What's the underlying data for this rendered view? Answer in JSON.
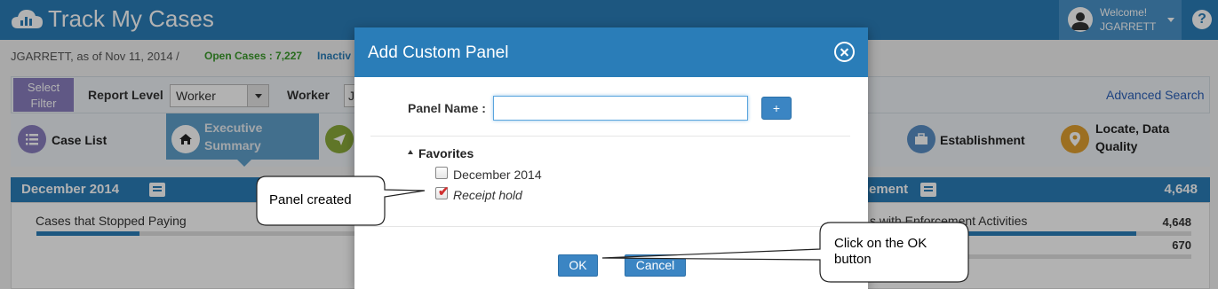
{
  "app": {
    "title": "Track My Cases",
    "user_greeting": "Welcome!",
    "user_name": "JGARRETT",
    "help_label": "?"
  },
  "subbar": {
    "breadcrumb": "JGARRETT, as of Nov 11, 2014  /",
    "open_cases": "Open Cases : 7,227",
    "inactive": "Inactiv"
  },
  "filter": {
    "select_filter": "Select Filter",
    "report_level_label": "Report Level",
    "report_level_value": "Worker",
    "worker_label": "Worker",
    "worker_value": "J",
    "advanced_search": "Advanced Search"
  },
  "tabs": [
    {
      "label": "Case List",
      "icon": "list-icon",
      "color": "#8a7fbf"
    },
    {
      "label": "Executive Summary",
      "icon": "home-icon",
      "color": "#ffffff",
      "active": true
    },
    {
      "label": "",
      "icon": "send-icon",
      "color": "#8aaa3a"
    },
    {
      "label": "Establishment",
      "icon": "briefcase-icon",
      "color": "#5a8fc4"
    },
    {
      "label": "Locate, Data Quality",
      "icon": "map-pin-icon",
      "color": "#e0a030"
    }
  ],
  "panels": {
    "left": {
      "title": "December 2014",
      "row_label": "Cases that Stopped Paying",
      "bar_fraction": 0.32
    },
    "right": {
      "title_partial": "ement",
      "total": "4,648",
      "row1_label": "s with Enforcement Activities",
      "row1_value": "4,648",
      "row1_fraction": 0.83,
      "row2_value": "670",
      "row2_fraction": 0.12
    }
  },
  "modal": {
    "title": "Add Custom Panel",
    "panel_name_label": "Panel Name :",
    "panel_name_value": "",
    "add_label": "+",
    "favorites_label": "Favorites",
    "favorites": [
      {
        "label": "December 2014",
        "checked": false
      },
      {
        "label": "Receipt hold",
        "checked": true
      }
    ],
    "ok_label": "OK",
    "cancel_label": "Cancel",
    "check_glyph": "✔"
  },
  "callouts": {
    "panel_created": "Panel created",
    "click_ok_line1": "Click on the OK",
    "click_ok_line2": "button"
  }
}
